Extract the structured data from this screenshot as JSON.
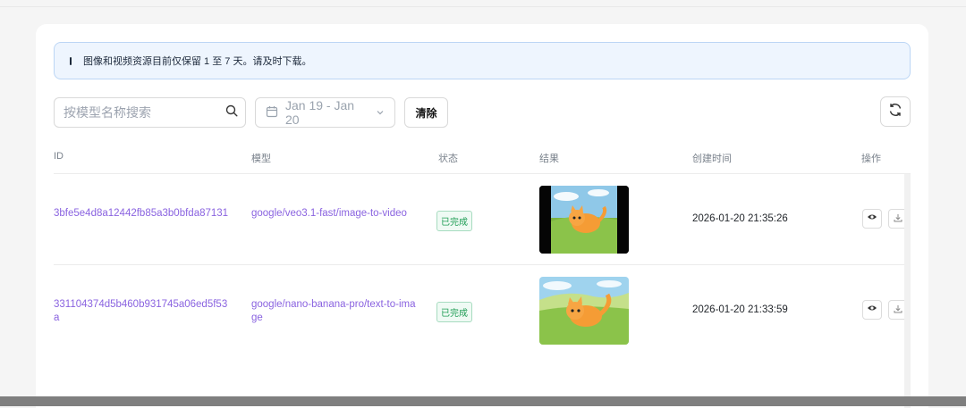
{
  "notice": {
    "text": "图像和视频资源目前仅保留 1 至 7 天。请及时下载。"
  },
  "filters": {
    "search_placeholder": "按模型名称搜索",
    "date_range": "Jan 19 - Jan 20",
    "clear_label": "清除"
  },
  "table": {
    "columns": [
      "ID",
      "模型",
      "状态",
      "结果",
      "创建时间",
      "操作"
    ],
    "rows": [
      {
        "id": "3bfe5e4d8a12442fb85a3b0bfda87131",
        "model": "google/veo3.1-fast/image-to-video",
        "status": "已完成",
        "result_type": "video",
        "created": "2026-01-20 21:35:26"
      },
      {
        "id": "331104374d5b460b931745a06ed5f53a",
        "model": "google/nano-banana-pro/text-to-image",
        "status": "已完成",
        "result_type": "image",
        "created": "2026-01-20 21:33:59"
      }
    ]
  },
  "icons": {
    "search": "search-icon",
    "calendar": "calendar-icon",
    "chevron": "chevron-down-icon",
    "refresh": "refresh-icon",
    "view": "eye-icon",
    "download": "download-icon"
  },
  "colors": {
    "link": "#8a63e0",
    "status_bg": "#effaf4",
    "status_text": "#1f9d55",
    "notice_bg": "#eef5fe",
    "notice_border": "#bcd6f5"
  }
}
